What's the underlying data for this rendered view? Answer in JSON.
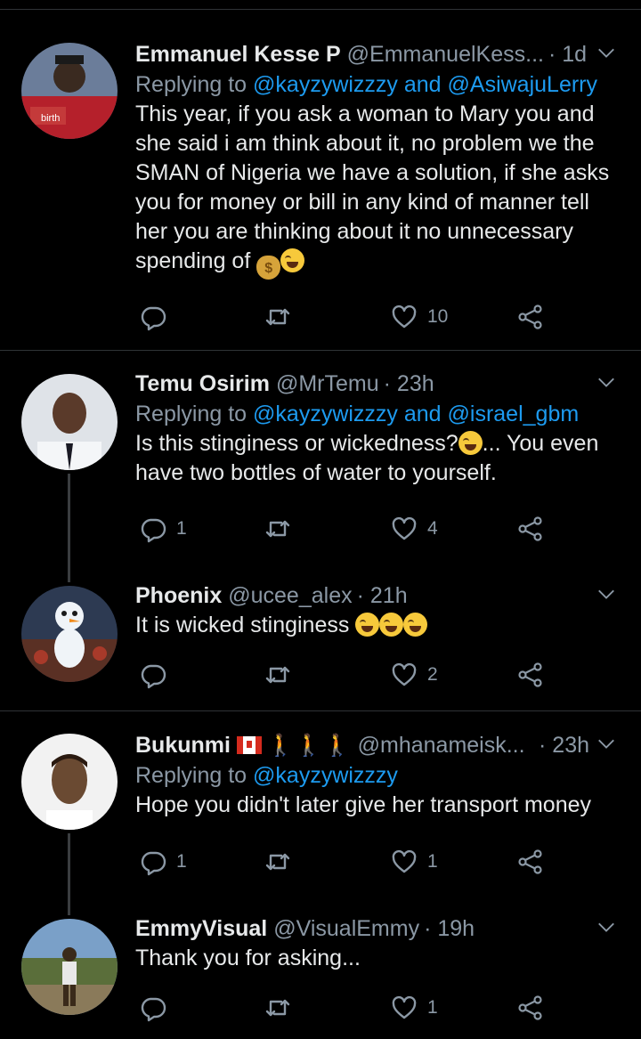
{
  "tweets": [
    {
      "name": "Emmanuel Kesse P",
      "handle": "@EmmanuelKess...",
      "time": "· 1d",
      "replying_prefix": "Replying to",
      "replying_mentions": "@kayzywizzzy and @AsiwajuLerry",
      "text": "This year, if you ask a woman to Mary you and she said i am think about it, no problem we the SMAN of Nigeria we have a solution, if she asks you for money or bill in any kind of manner tell her you are thinking about it no unnecessary spending of",
      "reply_count": "",
      "retweet_count": "",
      "like_count": "10",
      "avatar_colors": [
        "#8a1a22",
        "#c43a3a",
        "#2b2f55"
      ]
    },
    {
      "name": "Temu Osirim",
      "handle": "@MrTemu",
      "time": "· 23h",
      "replying_prefix": "Replying to",
      "replying_mentions": "@kayzywizzzy and @israel_gbm",
      "text_part1": "Is this stinginess or wickedness?",
      "text_part2": "... You even have two bottles of water to yourself.",
      "reply_count": "1",
      "retweet_count": "",
      "like_count": "4",
      "avatar_colors": [
        "#dfe3e8",
        "#5a3a2a",
        "#1a1a24"
      ]
    },
    {
      "name": "Phoenix",
      "handle": "@ucee_alex",
      "time": "· 21h",
      "text": "It is wicked stinginess",
      "reply_count": "",
      "retweet_count": "",
      "like_count": "2",
      "avatar_colors": [
        "#2d3a52",
        "#a83a2a",
        "#f0f4f8"
      ]
    },
    {
      "name": "Bukunmi",
      "handle": "@mhanameisk...",
      "time": "· 23h",
      "replying_prefix": "Replying to",
      "replying_mentions": "@kayzywizzzy",
      "text": "Hope you didn't later give her transport money",
      "reply_count": "1",
      "retweet_count": "",
      "like_count": "1",
      "avatar_colors": [
        "#f2f2f2",
        "#6a4a32",
        "#ffffff"
      ]
    },
    {
      "name": "EmmyVisual",
      "handle": "@VisualEmmy",
      "time": "· 19h",
      "text": "Thank you for asking...",
      "reply_count": "",
      "retweet_count": "",
      "like_count": "1",
      "avatar_colors": [
        "#7aa0c8",
        "#5a6e3a",
        "#3a2a1a"
      ]
    }
  ],
  "icons": {
    "reply": "reply-icon",
    "retweet": "retweet-icon",
    "like": "heart-icon",
    "share": "share-icon",
    "menu": "chevron-down-icon"
  },
  "colors": {
    "background": "#000000",
    "text": "#e7e9ea",
    "secondary": "#8b98a5",
    "link": "#1d9bf0",
    "divider": "#2f3336"
  }
}
